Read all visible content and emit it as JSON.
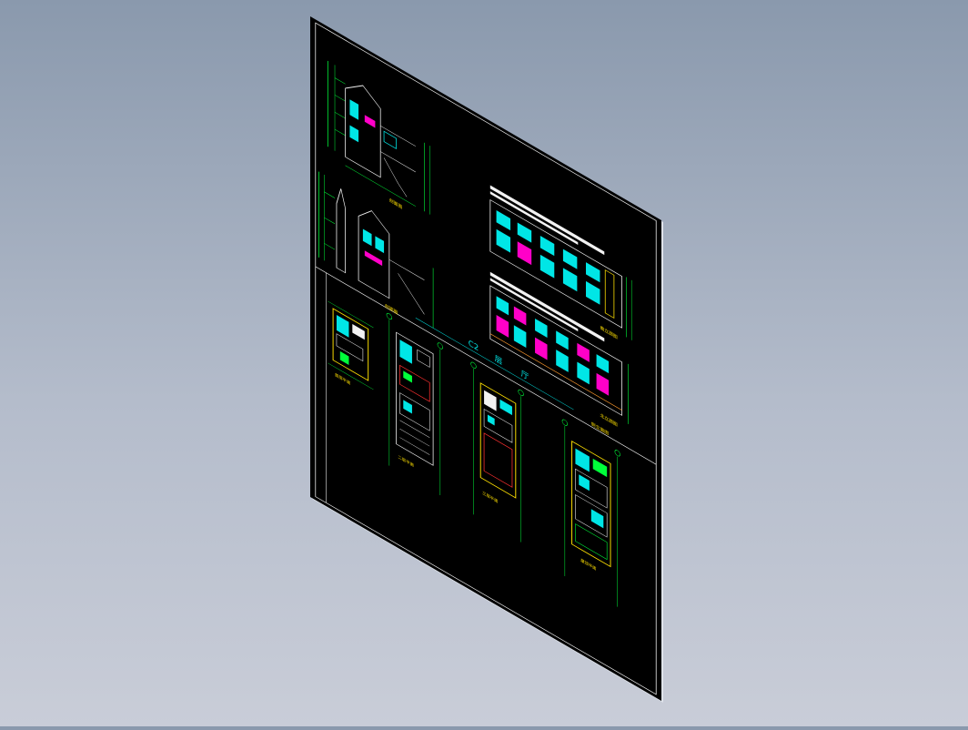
{
  "colors": {
    "background_top": "#8a99ad",
    "background_bottom": "#c9cdd8",
    "sheet": "#000000",
    "sheet_border": "#d9d9d9",
    "cad_green": "#00ff3a",
    "cad_cyan": "#00e6e6",
    "cad_yellow": "#ffe000",
    "cad_magenta": "#ff00c8",
    "cad_white": "#f2f2f2",
    "cad_red": "#ff3030",
    "cad_orange": "#ff9a2e"
  },
  "drawing": {
    "title_line1": "C2",
    "title_line2": "层",
    "title_line3": "厅",
    "section_label_top": "剖面图",
    "section_label_mid": "剖面图",
    "elevation_label_top": "南立面图",
    "elevation_label_mid": "北立面图",
    "elevation_label_bottom": "侧立面图",
    "plan_label_1": "首层平面",
    "plan_label_2": "二层平面",
    "plan_label_3": "三层平面",
    "plan_label_4": "屋顶平面"
  }
}
